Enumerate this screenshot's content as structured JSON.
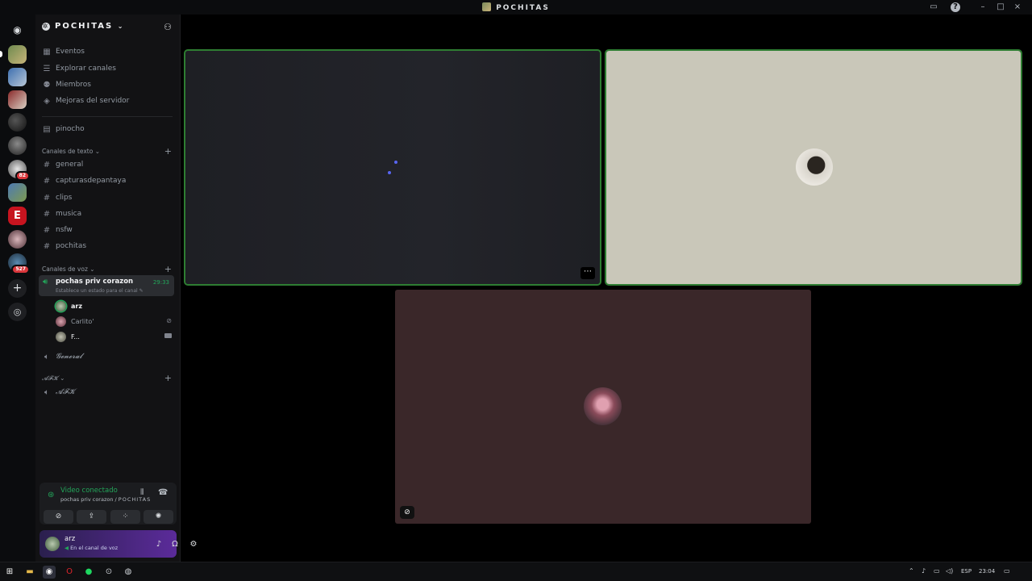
{
  "window": {
    "title": "POCHITAS"
  },
  "server": {
    "name": "POCHITAS",
    "badges": [
      "82",
      "527"
    ]
  },
  "menu": [
    {
      "label": "Eventos",
      "icon": "calendar-icon"
    },
    {
      "label": "Explorar canales",
      "icon": "browse-icon"
    },
    {
      "label": "Miembros",
      "icon": "members-icon"
    },
    {
      "label": "Mejoras del servidor",
      "icon": "boost-icon"
    }
  ],
  "pinned": {
    "label": "pinocho"
  },
  "text_category": {
    "label": "Canales de texto"
  },
  "text_channels": [
    "general",
    "capturasdepantaya",
    "clips",
    "musica",
    "nsfw",
    "pochitas"
  ],
  "voice_category": {
    "label": "Canales de voz"
  },
  "active_voice": {
    "name": "pochas priv corazon",
    "timer": "29:33",
    "status": "Establece un estado para el canal"
  },
  "voice_members": [
    "arz",
    "Carlito'",
    "F..."
  ],
  "other_voice": {
    "name": "𝓖𝓮𝓷𝓮𝓻𝓪𝓵"
  },
  "afk_category": {
    "label": "𝓐𝓕𝓚"
  },
  "afk_channel": {
    "name": "𝓐𝓕𝓚"
  },
  "connection": {
    "status": "Video conectado",
    "channel": "pochas priv corazon",
    "server": "POCHITAS"
  },
  "user": {
    "name": "arz",
    "status": "En el canal de voz"
  },
  "taskbar": {
    "lang": "ESP",
    "time": "23:04"
  },
  "colors": {
    "accent": "#23a55a",
    "panel": "#5b2b9a"
  }
}
